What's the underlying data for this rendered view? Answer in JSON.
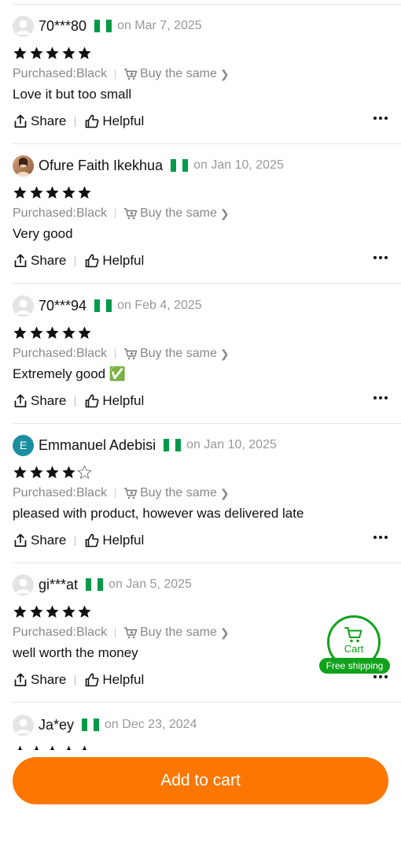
{
  "colors": {
    "accent_orange": "#fb7701",
    "star": "#111111",
    "muted": "#888888",
    "date": "#999999",
    "cart_green": "#11a21b",
    "flag_green": "#009a49"
  },
  "reviews": [
    {
      "username": "70***80",
      "avatar": "default-avatar",
      "country_flag": "nigeria-flag",
      "date": "on Mar 7, 2025",
      "rating": 5,
      "purchased": "Purchased:Black",
      "buy_same": "Buy the same",
      "text": "Love it but too small",
      "share": "Share",
      "helpful": "Helpful"
    },
    {
      "username": "Ofure Faith Ikekhua",
      "avatar": "user-photo",
      "country_flag": "nigeria-flag",
      "date": "on Jan 10, 2025",
      "rating": 5,
      "purchased": "Purchased:Black",
      "buy_same": "Buy the same",
      "text": "Very good",
      "share": "Share",
      "helpful": "Helpful"
    },
    {
      "username": "70***94",
      "avatar": "default-avatar",
      "country_flag": "nigeria-flag",
      "date": "on Feb 4, 2025",
      "rating": 5,
      "purchased": "Purchased:Black",
      "buy_same": "Buy the same",
      "text": "Extremely good ✅",
      "share": "Share",
      "helpful": "Helpful"
    },
    {
      "username": "Emmanuel Adebisi",
      "avatar": "initial-avatar",
      "avatar_initial": "E",
      "country_flag": "nigeria-flag",
      "date": "on Jan 10, 2025",
      "rating": 4,
      "purchased": "Purchased:Black",
      "buy_same": "Buy the same",
      "text": "pleased with product, however was delivered late",
      "share": "Share",
      "helpful": "Helpful"
    },
    {
      "username": "gi***at",
      "avatar": "default-avatar",
      "country_flag": "nigeria-flag",
      "date": "on Jan 5, 2025",
      "rating": 5,
      "purchased": "Purchased:Black",
      "buy_same": "Buy the same",
      "text": "well worth the money",
      "share": "Share",
      "helpful": "Helpful"
    },
    {
      "username": "Ja*ey",
      "avatar": "default-avatar",
      "country_flag": "nigeria-flag",
      "date": "on Dec 23, 2024",
      "rating": 5
    }
  ],
  "cart_fab": {
    "label": "Cart",
    "badge": "Free shipping",
    "icon": "cart-icon"
  },
  "bottom_bar": {
    "add_to_cart": "Add to cart"
  }
}
